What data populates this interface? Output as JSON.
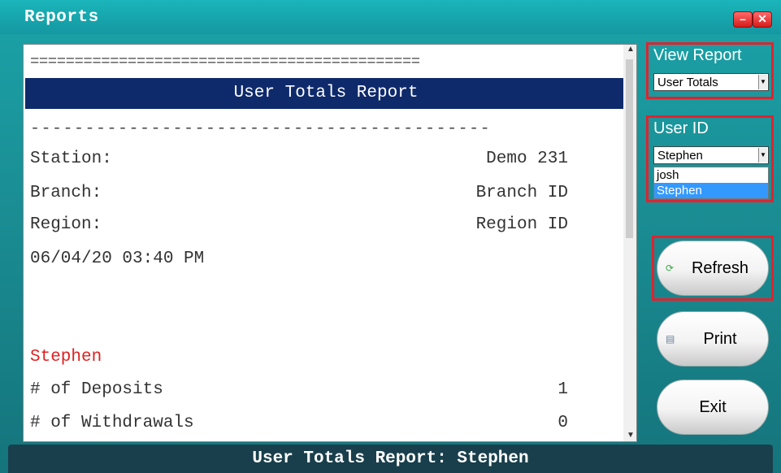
{
  "window": {
    "title": "Reports",
    "minimize_label": "–",
    "close_label": "✕"
  },
  "report": {
    "double_rule": "============================================",
    "header": "User Totals Report",
    "single_rule": "------------------------------------------",
    "rows": [
      {
        "label": "Station:",
        "value": "Demo 231"
      },
      {
        "label": "Branch:",
        "value": "Branch ID"
      },
      {
        "label": "Region:",
        "value": "Region ID"
      }
    ],
    "datetime": "06/04/20 03:40 PM",
    "user_name": "Stephen",
    "stats": [
      {
        "label": "# of Deposits",
        "value": "1"
      },
      {
        "label": "# of Withdrawals",
        "value": "0"
      }
    ]
  },
  "view_report": {
    "label": "View Report",
    "selected": "User Totals"
  },
  "user_id": {
    "label": "User ID",
    "selected": "Stephen",
    "options": [
      "josh",
      "Stephen"
    ],
    "highlighted": "Stephen"
  },
  "buttons": {
    "refresh": "Refresh",
    "print": "Print",
    "exit": "Exit"
  },
  "icons": {
    "refresh": "refresh-icon",
    "print": "printer-icon",
    "minimize": "minimize-icon",
    "close": "close-icon"
  },
  "status": {
    "text": "User Totals Report: Stephen"
  },
  "colors": {
    "accent_teal": "#1aa3a8",
    "header_navy": "#0e2a6b",
    "highlight_red": "#e0232e",
    "user_red": "#e02020",
    "selection_blue": "#3399ff",
    "status_bar": "#193f4c"
  }
}
